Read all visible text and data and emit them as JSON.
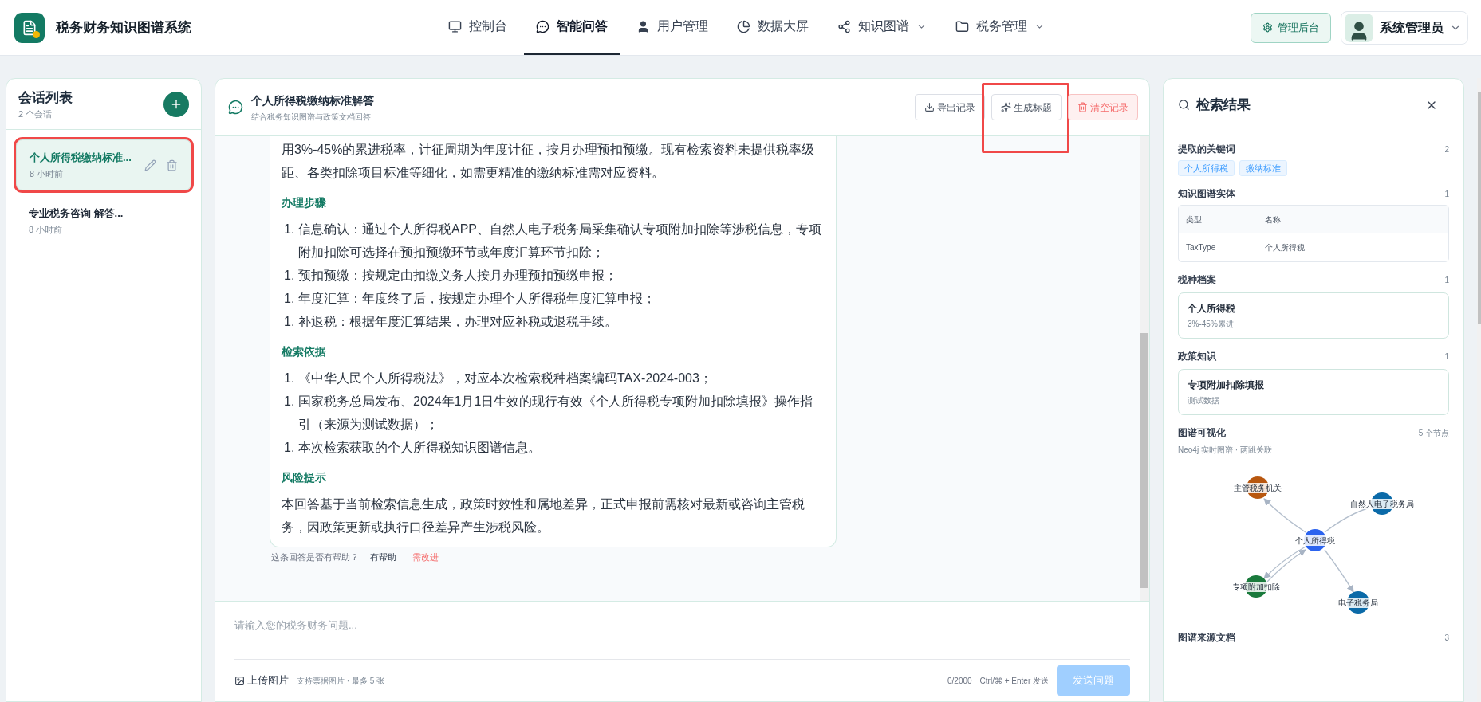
{
  "app": {
    "title": "税务财务知识图谱系统"
  },
  "nav": [
    {
      "label": "控制台",
      "dropdown": false,
      "selected": false
    },
    {
      "label": "智能问答",
      "dropdown": false,
      "selected": true
    },
    {
      "label": "用户管理",
      "dropdown": false,
      "selected": false
    },
    {
      "label": "数据大屏",
      "dropdown": false,
      "selected": false
    },
    {
      "label": "知识图谱",
      "dropdown": true,
      "selected": false
    },
    {
      "label": "税务管理",
      "dropdown": true,
      "selected": false
    }
  ],
  "header_actions": {
    "admin_button": "管理后台",
    "user_name": "系统管理员"
  },
  "sessions": {
    "title": "会话列表",
    "count": "2 个会话",
    "items": [
      {
        "title": "个人所得税缴纳标准...",
        "time": "8 小时前",
        "selected": true,
        "annotated": true
      },
      {
        "title": "专业税务咨询 解答...",
        "time": "8 小时前",
        "selected": false,
        "annotated": false
      }
    ]
  },
  "chat": {
    "title": "个人所得税缴纳标准解答",
    "subtitle": "结合税务知识图谱与政策文档回答",
    "actions": [
      {
        "label": "导出记录",
        "kind": "default",
        "annotated": false
      },
      {
        "label": "生成标题",
        "kind": "default",
        "annotated": true
      },
      {
        "label": "清空记录",
        "kind": "danger",
        "annotated": false
      }
    ],
    "answer": [
      {
        "kind": "paragraph",
        "text": "用3%-45%的累进税率，计征周期为年度计征，按月办理预扣预缴。现有检索资料未提供税率级距、各类扣除项目标准等细化，如需更精准的缴纳标准需对应资料。"
      },
      {
        "kind": "heading",
        "text": "办理步骤"
      },
      {
        "kind": "list",
        "items": [
          {
            "marker": "1.",
            "text": "信息确认：通过个人所得税APP、自然人电子税务局采集确认专项附加扣除等涉税信息，专项附加扣除可选择在预扣预缴环节或年度汇算环节扣除；"
          },
          {
            "marker": "1.",
            "text": "预扣预缴：按规定由扣缴义务人按月办理预扣预缴申报；"
          },
          {
            "marker": "1.",
            "text": "年度汇算：年度终了后，按规定办理个人所得税年度汇算申报；"
          },
          {
            "marker": "1.",
            "text": "补退税：根据年度汇算结果，办理对应补税或退税手续。"
          }
        ]
      },
      {
        "kind": "heading",
        "text": "检索依据"
      },
      {
        "kind": "list",
        "items": [
          {
            "marker": "1.",
            "text": "《中华人民个人所得税法》，对应本次检索税种档案编码TAX-2024-003；"
          },
          {
            "marker": "1.",
            "text": "国家税务总局发布、2024年1月1日生效的现行有效《个人所得税专项附加扣除填报》操作指引（来源为测试数据）；"
          },
          {
            "marker": "1.",
            "text": "本次检索获取的个人所得税知识图谱信息。"
          }
        ]
      },
      {
        "kind": "heading",
        "text": "风险提示"
      },
      {
        "kind": "paragraph",
        "text": "本回答基于当前检索信息生成，政策时效性和属地差异，正式申报前需核对最新或咨询主管税务，因政策更新或执行口径差异产生涉税风险。"
      }
    ],
    "feedback": {
      "question": "这条回答是否有帮助？",
      "helpful": "有帮助",
      "improve": "需改进"
    },
    "input": {
      "placeholder": "请输入您的税务财务问题...",
      "upload": "上传图片",
      "upload_hint": "支持票据图片 · 最多 5 张",
      "counter": "0/2000",
      "shortcut": "Ctrl/⌘ + Enter 发送",
      "send": {
        "label": "发送问题",
        "disabled": true
      }
    }
  },
  "results": {
    "title": "检索结果",
    "sections": [
      {
        "kind": "tags",
        "title": "提取的关键词",
        "count": "2",
        "tags": [
          "个人所得税",
          "缴纳标准"
        ]
      },
      {
        "kind": "table",
        "title": "知识图谱实体",
        "count": "1",
        "columns": [
          "类型",
          "名称"
        ],
        "rows": [
          [
            "TaxType",
            "个人所得税"
          ]
        ]
      },
      {
        "kind": "cards",
        "title": "税种档案",
        "count": "1",
        "cards": [
          {
            "title": "个人所得税",
            "subtitle": "3%-45%累进"
          }
        ]
      },
      {
        "kind": "cards",
        "title": "政策知识",
        "count": "1",
        "cards": [
          {
            "title": "专项附加扣除填报",
            "subtitle": "测试数据"
          }
        ]
      },
      {
        "kind": "graph",
        "title": "图谱可视化",
        "count": "5 个节点",
        "subtitle": "Neo4j 实时图谱 · 两跳关联",
        "nodes": [
          {
            "label": "主管税务机关",
            "color": "#b8570f"
          },
          {
            "label": "自然人电子税务局",
            "color": "#0b6aa8"
          },
          {
            "label": "个人所得税",
            "color": "#2b63ef"
          },
          {
            "label": "专项附加扣除",
            "color": "#1a7a3c"
          },
          {
            "label": "电子税务局",
            "color": "#0b6aa8"
          }
        ]
      },
      {
        "kind": "plain",
        "title": "图谱来源文档",
        "count": "3"
      }
    ]
  }
}
